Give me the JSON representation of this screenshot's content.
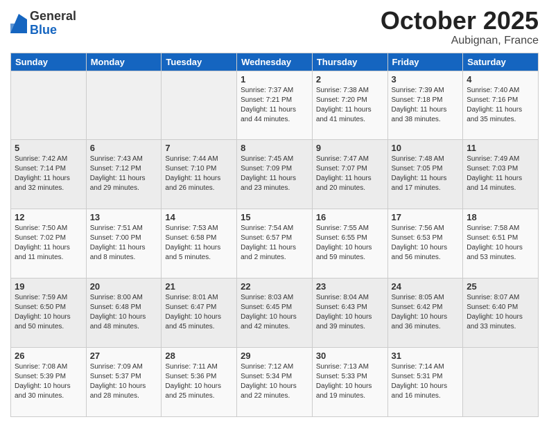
{
  "header": {
    "logo_general": "General",
    "logo_blue": "Blue",
    "month": "October 2025",
    "location": "Aubignan, France"
  },
  "days_of_week": [
    "Sunday",
    "Monday",
    "Tuesday",
    "Wednesday",
    "Thursday",
    "Friday",
    "Saturday"
  ],
  "weeks": [
    [
      {
        "num": "",
        "info": ""
      },
      {
        "num": "",
        "info": ""
      },
      {
        "num": "",
        "info": ""
      },
      {
        "num": "1",
        "info": "Sunrise: 7:37 AM\nSunset: 7:21 PM\nDaylight: 11 hours and 44 minutes."
      },
      {
        "num": "2",
        "info": "Sunrise: 7:38 AM\nSunset: 7:20 PM\nDaylight: 11 hours and 41 minutes."
      },
      {
        "num": "3",
        "info": "Sunrise: 7:39 AM\nSunset: 7:18 PM\nDaylight: 11 hours and 38 minutes."
      },
      {
        "num": "4",
        "info": "Sunrise: 7:40 AM\nSunset: 7:16 PM\nDaylight: 11 hours and 35 minutes."
      }
    ],
    [
      {
        "num": "5",
        "info": "Sunrise: 7:42 AM\nSunset: 7:14 PM\nDaylight: 11 hours and 32 minutes."
      },
      {
        "num": "6",
        "info": "Sunrise: 7:43 AM\nSunset: 7:12 PM\nDaylight: 11 hours and 29 minutes."
      },
      {
        "num": "7",
        "info": "Sunrise: 7:44 AM\nSunset: 7:10 PM\nDaylight: 11 hours and 26 minutes."
      },
      {
        "num": "8",
        "info": "Sunrise: 7:45 AM\nSunset: 7:09 PM\nDaylight: 11 hours and 23 minutes."
      },
      {
        "num": "9",
        "info": "Sunrise: 7:47 AM\nSunset: 7:07 PM\nDaylight: 11 hours and 20 minutes."
      },
      {
        "num": "10",
        "info": "Sunrise: 7:48 AM\nSunset: 7:05 PM\nDaylight: 11 hours and 17 minutes."
      },
      {
        "num": "11",
        "info": "Sunrise: 7:49 AM\nSunset: 7:03 PM\nDaylight: 11 hours and 14 minutes."
      }
    ],
    [
      {
        "num": "12",
        "info": "Sunrise: 7:50 AM\nSunset: 7:02 PM\nDaylight: 11 hours and 11 minutes."
      },
      {
        "num": "13",
        "info": "Sunrise: 7:51 AM\nSunset: 7:00 PM\nDaylight: 11 hours and 8 minutes."
      },
      {
        "num": "14",
        "info": "Sunrise: 7:53 AM\nSunset: 6:58 PM\nDaylight: 11 hours and 5 minutes."
      },
      {
        "num": "15",
        "info": "Sunrise: 7:54 AM\nSunset: 6:57 PM\nDaylight: 11 hours and 2 minutes."
      },
      {
        "num": "16",
        "info": "Sunrise: 7:55 AM\nSunset: 6:55 PM\nDaylight: 10 hours and 59 minutes."
      },
      {
        "num": "17",
        "info": "Sunrise: 7:56 AM\nSunset: 6:53 PM\nDaylight: 10 hours and 56 minutes."
      },
      {
        "num": "18",
        "info": "Sunrise: 7:58 AM\nSunset: 6:51 PM\nDaylight: 10 hours and 53 minutes."
      }
    ],
    [
      {
        "num": "19",
        "info": "Sunrise: 7:59 AM\nSunset: 6:50 PM\nDaylight: 10 hours and 50 minutes."
      },
      {
        "num": "20",
        "info": "Sunrise: 8:00 AM\nSunset: 6:48 PM\nDaylight: 10 hours and 48 minutes."
      },
      {
        "num": "21",
        "info": "Sunrise: 8:01 AM\nSunset: 6:47 PM\nDaylight: 10 hours and 45 minutes."
      },
      {
        "num": "22",
        "info": "Sunrise: 8:03 AM\nSunset: 6:45 PM\nDaylight: 10 hours and 42 minutes."
      },
      {
        "num": "23",
        "info": "Sunrise: 8:04 AM\nSunset: 6:43 PM\nDaylight: 10 hours and 39 minutes."
      },
      {
        "num": "24",
        "info": "Sunrise: 8:05 AM\nSunset: 6:42 PM\nDaylight: 10 hours and 36 minutes."
      },
      {
        "num": "25",
        "info": "Sunrise: 8:07 AM\nSunset: 6:40 PM\nDaylight: 10 hours and 33 minutes."
      }
    ],
    [
      {
        "num": "26",
        "info": "Sunrise: 7:08 AM\nSunset: 5:39 PM\nDaylight: 10 hours and 30 minutes."
      },
      {
        "num": "27",
        "info": "Sunrise: 7:09 AM\nSunset: 5:37 PM\nDaylight: 10 hours and 28 minutes."
      },
      {
        "num": "28",
        "info": "Sunrise: 7:11 AM\nSunset: 5:36 PM\nDaylight: 10 hours and 25 minutes."
      },
      {
        "num": "29",
        "info": "Sunrise: 7:12 AM\nSunset: 5:34 PM\nDaylight: 10 hours and 22 minutes."
      },
      {
        "num": "30",
        "info": "Sunrise: 7:13 AM\nSunset: 5:33 PM\nDaylight: 10 hours and 19 minutes."
      },
      {
        "num": "31",
        "info": "Sunrise: 7:14 AM\nSunset: 5:31 PM\nDaylight: 10 hours and 16 minutes."
      },
      {
        "num": "",
        "info": ""
      }
    ]
  ]
}
